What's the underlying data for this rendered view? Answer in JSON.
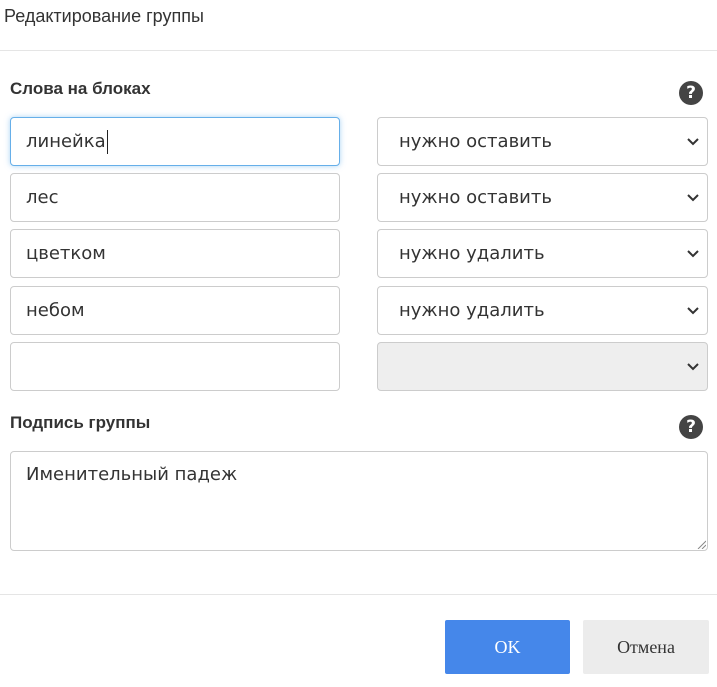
{
  "dialog": {
    "title": "Редактирование группы"
  },
  "words_section": {
    "label": "Слова на блоках",
    "help_icon": "question-circle-icon",
    "rows": [
      {
        "word": "линейка",
        "action": "нужно оставить"
      },
      {
        "word": "лес",
        "action": "нужно оставить"
      },
      {
        "word": "цветком",
        "action": "нужно удалить"
      },
      {
        "word": "небом",
        "action": "нужно удалить"
      },
      {
        "word": "",
        "action": ""
      }
    ]
  },
  "caption_section": {
    "label": "Подпись группы",
    "help_icon": "question-circle-icon",
    "value": "Именительный падеж"
  },
  "footer": {
    "ok_label": "OK",
    "cancel_label": "Отмена"
  },
  "colors": {
    "ok_button": "#4587ea",
    "cancel_button": "#ececec",
    "focus_border": "#66afe9",
    "disabled_select": "#eeeeee"
  }
}
